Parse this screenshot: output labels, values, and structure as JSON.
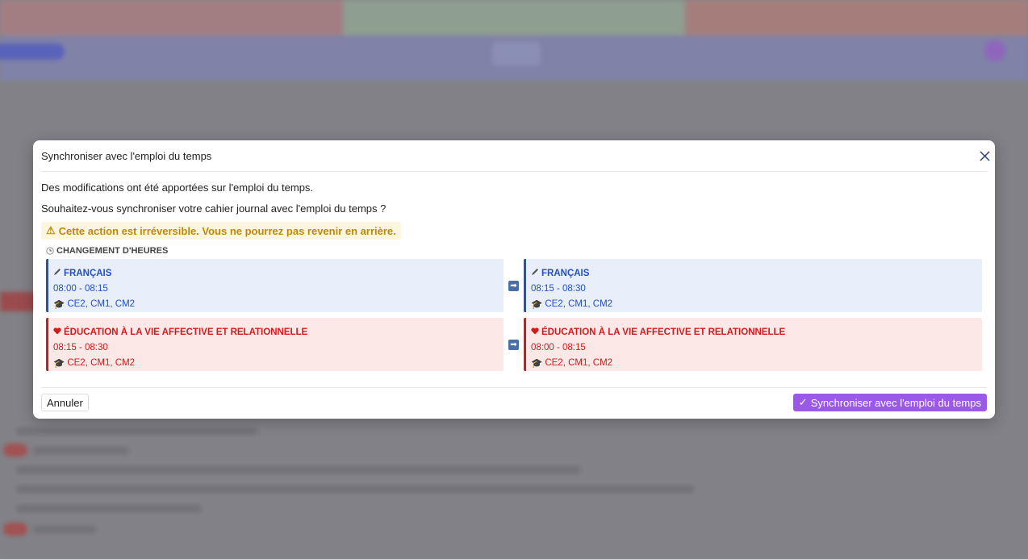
{
  "colors": {
    "accent": "#9b59e8",
    "blue_course": "#2150c8",
    "red_course": "#d11b1b",
    "warning_text": "#c08a00",
    "top_bar": [
      "#b98a8e",
      "#9fb39f",
      "#bd8a86"
    ]
  },
  "modal": {
    "title": "Synchroniser avec l'emploi du temps",
    "line1": "Des modifications ont été apportées sur l'emploi du temps.",
    "line2": "Souhaitez-vous synchroniser votre cahier journal avec l'emploi du temps ?",
    "warning": "Cette action est irréversible. Vous ne pourrez pas revenir en arrière.",
    "section_title": "CHANGEMENT D'HEURES",
    "changes": [
      {
        "color": "blue",
        "icon": "pencil-icon",
        "before": {
          "subject": "FRANÇAIS",
          "time": "08:00 - 08:15",
          "classes": "CE2, CM1, CM2"
        },
        "after": {
          "subject": "FRANÇAIS",
          "time": "08:15 - 08:30",
          "classes": "CE2, CM1, CM2"
        }
      },
      {
        "color": "red",
        "icon": "heart-icon",
        "before": {
          "subject": "ÉDUCATION À LA VIE AFFECTIVE ET RELATIONNELLE",
          "time": "08:15 - 08:30",
          "classes": "CE2, CM1, CM2"
        },
        "after": {
          "subject": "ÉDUCATION À LA VIE AFFECTIVE ET RELATIONNELLE",
          "time": "08:00 - 08:15",
          "classes": "CE2, CM1, CM2"
        }
      }
    ],
    "cancel_label": "Annuler",
    "sync_label": "Synchroniser avec l'emploi du temps"
  }
}
